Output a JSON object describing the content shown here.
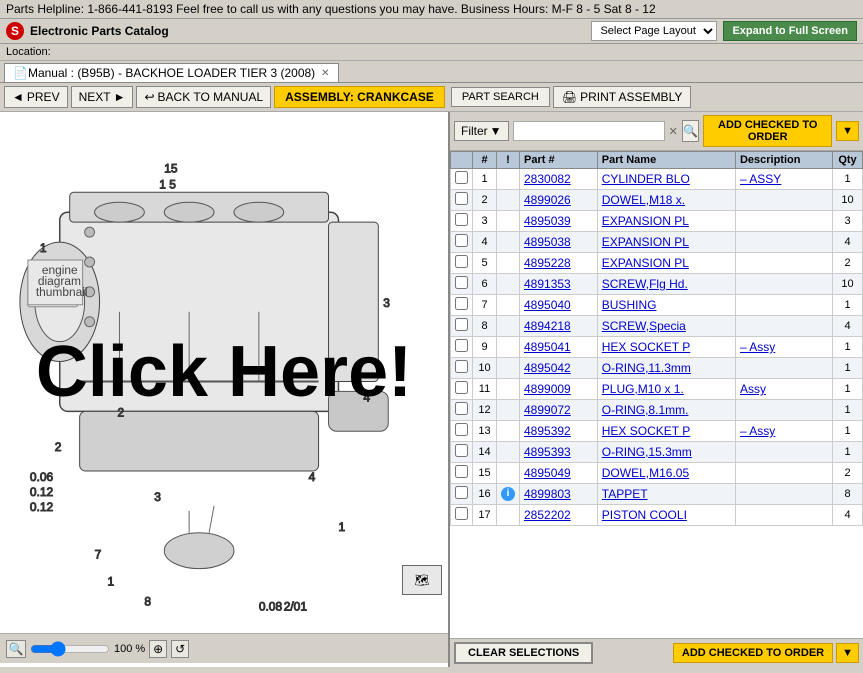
{
  "topbar": {
    "helpline": "Parts Helpline: 1-866-441-8193 Feel free to call us with any questions you may have. Business Hours: M-F 8 - 5 Sat 8 - 12"
  },
  "titlebar": {
    "logo": "S",
    "app_title": "Electronic Parts Catalog",
    "layout_label": "Select Page Layout",
    "expand_btn": "Expand to Full Screen"
  },
  "location": {
    "label": "Location:"
  },
  "tab": {
    "label": "Manual : (B95B) - BACKHOE LOADER TIER 3 (2008)"
  },
  "toolbar": {
    "prev_label": "PREV",
    "next_label": "NEXT",
    "back_label": "BACK TO MANUAL",
    "assembly_label": "ASSEMBLY: CRANKCASE",
    "part_search_label": "PART SEARCH",
    "print_label": "PRINT ASSEMBLY"
  },
  "filter": {
    "label": "Filter",
    "placeholder": "",
    "search_icon": "🔍",
    "clear_icon": "✕",
    "add_order_label": "ADD CHECKED TO ORDER"
  },
  "table": {
    "headers": [
      "",
      "#",
      "!",
      "Part #",
      "Part Name",
      "Description",
      "Qty"
    ],
    "rows": [
      {
        "check": false,
        "num": "1",
        "warn": "",
        "part": "2830082",
        "name": "CYLINDER BLO",
        "desc": "– ASSY",
        "qty": "1"
      },
      {
        "check": false,
        "num": "2",
        "warn": "",
        "part": "4899026",
        "name": "DOWEL,M18 x.",
        "desc": "",
        "qty": "10"
      },
      {
        "check": false,
        "num": "3",
        "warn": "",
        "part": "4895039",
        "name": "EXPANSION PL",
        "desc": "",
        "qty": "3"
      },
      {
        "check": false,
        "num": "4",
        "warn": "",
        "part": "4895038",
        "name": "EXPANSION PL",
        "desc": "",
        "qty": "4"
      },
      {
        "check": false,
        "num": "5",
        "warn": "",
        "part": "4895228",
        "name": "EXPANSION PL",
        "desc": "",
        "qty": "2"
      },
      {
        "check": false,
        "num": "6",
        "warn": "",
        "part": "4891353",
        "name": "SCREW,Flg Hd.",
        "desc": "",
        "qty": "10"
      },
      {
        "check": false,
        "num": "7",
        "warn": "",
        "part": "4895040",
        "name": "BUSHING",
        "desc": "",
        "qty": "1"
      },
      {
        "check": false,
        "num": "8",
        "warn": "",
        "part": "4894218",
        "name": "SCREW,Specia",
        "desc": "",
        "qty": "4"
      },
      {
        "check": false,
        "num": "9",
        "warn": "",
        "part": "4895041",
        "name": "HEX SOCKET P",
        "desc": "– Assy",
        "qty": "1"
      },
      {
        "check": false,
        "num": "10",
        "warn": "",
        "part": "4895042",
        "name": "O-RING,11.3mm",
        "desc": "",
        "qty": "1"
      },
      {
        "check": false,
        "num": "11",
        "warn": "",
        "part": "4899009",
        "name": "PLUG,M10 x 1.",
        "desc": "Assy",
        "qty": "1"
      },
      {
        "check": false,
        "num": "12",
        "warn": "",
        "part": "4899072",
        "name": "O-RING,8.1mm.",
        "desc": "",
        "qty": "1"
      },
      {
        "check": false,
        "num": "13",
        "warn": "",
        "part": "4895392",
        "name": "HEX SOCKET P",
        "desc": "– Assy",
        "qty": "1"
      },
      {
        "check": false,
        "num": "14",
        "warn": "",
        "part": "4895393",
        "name": "O-RING,15.3mm",
        "desc": "",
        "qty": "1"
      },
      {
        "check": false,
        "num": "15",
        "warn": "",
        "part": "4895049",
        "name": "DOWEL,M16.05",
        "desc": "",
        "qty": "2"
      },
      {
        "check": false,
        "num": "16",
        "warn": "info",
        "part": "4899803",
        "name": "TAPPET",
        "desc": "",
        "qty": "8"
      },
      {
        "check": false,
        "num": "17",
        "warn": "",
        "part": "2852202",
        "name": "PISTON COOLI",
        "desc": "",
        "qty": "4"
      }
    ]
  },
  "footer": {
    "clear_label": "CLEAR SELECTIONS",
    "add_order_label": "ADD CHECKED TO ORDER"
  },
  "diagram": {
    "click_overlay": "Click Here!",
    "zoom_pct": "100 %"
  }
}
